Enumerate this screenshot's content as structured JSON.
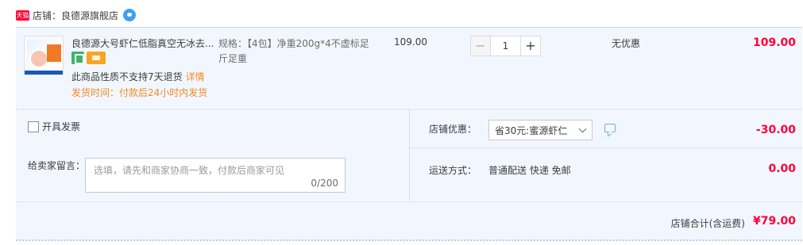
{
  "shop": {
    "logo_text": "天猫",
    "label": "店铺：",
    "name": "良德源旗舰店"
  },
  "item": {
    "title": "良德源大号虾仁低脂真空无冰去...",
    "spec_label": "规格：",
    "spec_value": "【4包】净重200g*4不虚标足斤足重",
    "unit_price": "109.00",
    "quantity": "1",
    "minus_label": "−",
    "plus_label": "+",
    "promo": "无优惠",
    "subtotal": "109.00",
    "return_notice": "此商品性质不支持7天退货",
    "detail_link": "详情",
    "ship_time": "发货时间：付款后24小时内发货"
  },
  "options": {
    "invoice_label": "开具发票",
    "message_label": "给卖家留言：",
    "message_placeholder": "选填，请先和商家协商一致，付款后商家可见",
    "message_count": "0/200",
    "shop_promo_label": "店铺优惠：",
    "shop_promo_selected": "省30元:蜜源虾仁",
    "shop_discount": "-30.00",
    "shipping_label": "运送方式：",
    "shipping_value": "普通配送 快递 免邮",
    "shipping_fee": "0.00"
  },
  "total": {
    "label": "店铺合计(含运费)",
    "value": "¥79.00"
  },
  "colors": {
    "accent_red": "#ff0036",
    "orange_text": "#f08a24",
    "row_bg": "#f2f7ff"
  }
}
